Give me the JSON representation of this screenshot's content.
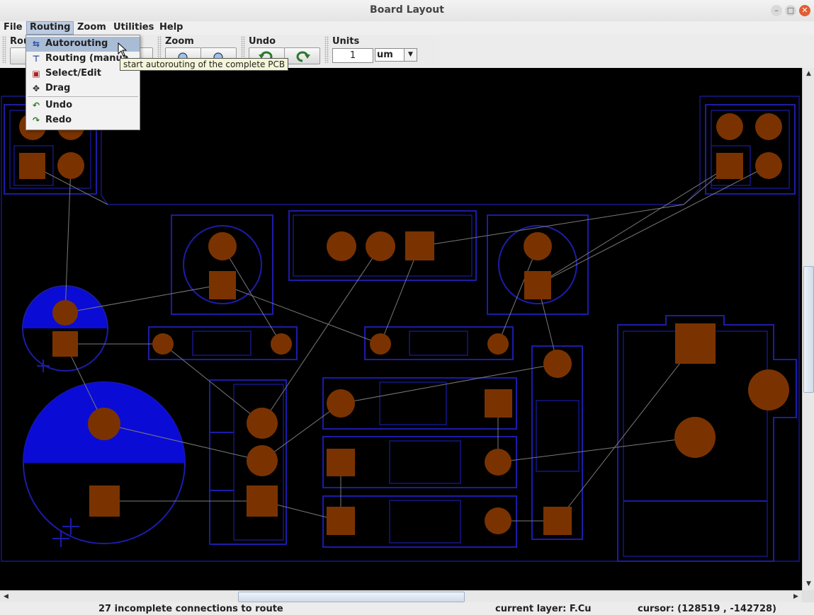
{
  "window": {
    "title": "Board Layout"
  },
  "menubar": {
    "items": [
      "File",
      "Routing",
      "Zoom",
      "Utilities",
      "Help"
    ]
  },
  "toolbar": {
    "routing_label": "Rou",
    "zoom_label": "Zoom",
    "undo_label": "Undo",
    "units_label": "Units",
    "units_value": "1",
    "units_unit": "um"
  },
  "routing_menu": {
    "items": [
      {
        "label": "Autorouting",
        "icon": "autoroute-icon"
      },
      {
        "label": "Routing (manua",
        "icon": "manual-route-icon"
      },
      {
        "label": "Select/Edit",
        "icon": "select-edit-icon"
      },
      {
        "label": "Drag",
        "icon": "drag-icon"
      },
      {
        "label": "Undo",
        "icon": "undo-icon"
      },
      {
        "label": "Redo",
        "icon": "redo-icon"
      }
    ],
    "tooltip": "start autorouting of the complete PCB"
  },
  "status": {
    "message": "27 incomplete connections to route",
    "layer": "current layer: F.Cu",
    "cursor": "cursor: (128519 , -142728)"
  },
  "colors": {
    "pad": "#7a3300",
    "outline": "#1c1ca8",
    "fill": "#0b0bd6",
    "ratsnest": "#7a7a7a"
  }
}
